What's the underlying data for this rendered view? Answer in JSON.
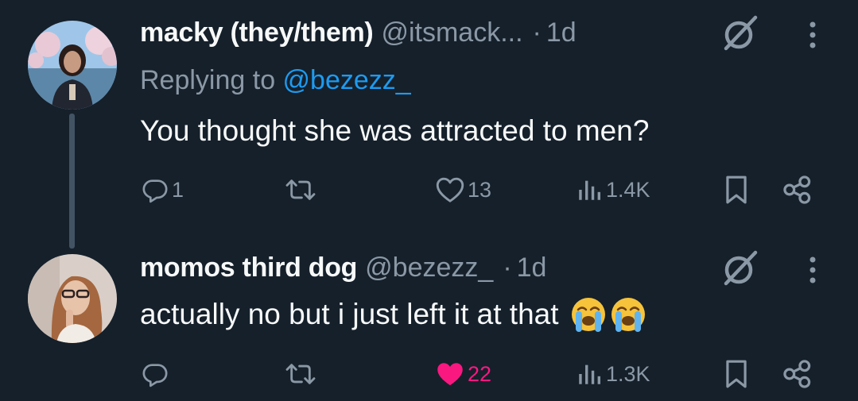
{
  "tweets": [
    {
      "name": "macky (they/them)",
      "handle": "@itsmack...",
      "dot": "·",
      "time": "1d",
      "replying_prefix": "Replying to ",
      "replying_handle": "@bezezz_",
      "text": "You thought she was attracted to men?",
      "actions": {
        "reply_count": "1",
        "retweet_count": "",
        "like_count": "13",
        "views_count": "1.4K"
      },
      "liked": false
    },
    {
      "name": "momos third dog",
      "handle": "@bezezz_",
      "dot": "·",
      "time": "1d",
      "text": "actually no but i just left it at that",
      "emojis": [
        "loudly-crying-face",
        "loudly-crying-face"
      ],
      "actions": {
        "reply_count": "",
        "retweet_count": "",
        "like_count": "22",
        "views_count": "1.3K"
      },
      "liked": true
    }
  ],
  "colors": {
    "background": "#15202b",
    "text": "#f7f9f9",
    "muted": "#8b98a5",
    "link": "#1d9bf0",
    "like": "#f91880",
    "thread_line": "#425364"
  }
}
